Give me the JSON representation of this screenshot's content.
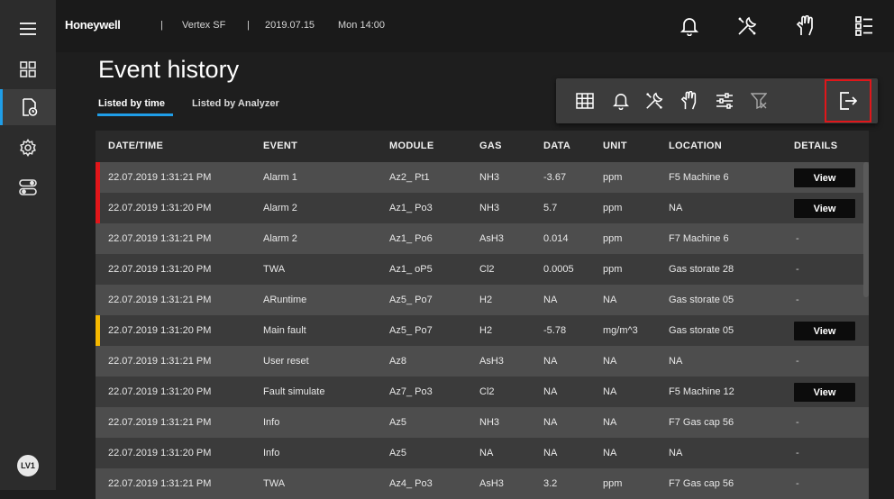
{
  "brand": "Honeywell",
  "header": {
    "separator": "|",
    "site": "Vertex SF",
    "date": "2019.07.15",
    "time": "Mon 14:00"
  },
  "page_title": "Event history",
  "tabs": [
    {
      "label": "Listed by time",
      "active": true
    },
    {
      "label": "Listed by Analyzer",
      "active": false
    }
  ],
  "user_badge": "LV1",
  "columns": [
    "DATE/TIME",
    "EVENT",
    "MODULE",
    "GAS",
    "DATA",
    "UNIT",
    "LOCATION",
    "DETAILS"
  ],
  "rows": [
    {
      "datetime": "22.07.2019 1:31:21 PM",
      "event": "Alarm 1",
      "module": "Az2_ Pt1",
      "gas": "NH3",
      "data": "-3.67",
      "unit": "ppm",
      "location": "F5 Machine 6",
      "details": "View",
      "marker": "#e0161a"
    },
    {
      "datetime": "22.07.2019 1:31:20 PM",
      "event": "Alarm 2",
      "module": "Az1_ Po3",
      "gas": "NH3",
      "data": "5.7",
      "unit": "ppm",
      "location": "NA",
      "details": "View",
      "marker": "#e0161a"
    },
    {
      "datetime": "22.07.2019 1:31:21 PM",
      "event": "Alarm 2",
      "module": "Az1_ Po6",
      "gas": "AsH3",
      "data": "0.014",
      "unit": "ppm",
      "location": "F7 Machine 6",
      "details": "-",
      "marker": ""
    },
    {
      "datetime": "22.07.2019 1:31:20 PM",
      "event": "TWA",
      "module": "Az1_ oP5",
      "gas": "Cl2",
      "data": "0.0005",
      "unit": "ppm",
      "location": "Gas storate 28",
      "details": "-",
      "marker": ""
    },
    {
      "datetime": "22.07.2019 1:31:21 PM",
      "event": "ARuntime",
      "module": "Az5_ Po7",
      "gas": "H2",
      "data": "NA",
      "unit": "NA",
      "location": "Gas storate 05",
      "details": "-",
      "marker": ""
    },
    {
      "datetime": "22.07.2019 1:31:20 PM",
      "event": "Main fault",
      "module": "Az5_ Po7",
      "gas": "H2",
      "data": "-5.78",
      "unit": "mg/m^3",
      "location": "Gas storate 05",
      "details": "View",
      "marker": "#f5b800"
    },
    {
      "datetime": "22.07.2019 1:31:21 PM",
      "event": "User reset",
      "module": "Az8",
      "gas": "AsH3",
      "data": "NA",
      "unit": "NA",
      "location": "NA",
      "details": "-",
      "marker": ""
    },
    {
      "datetime": "22.07.2019 1:31:20 PM",
      "event": "Fault simulate",
      "module": "Az7_ Po3",
      "gas": "Cl2",
      "data": "NA",
      "unit": "NA",
      "location": "F5 Machine 12",
      "details": "View",
      "marker": ""
    },
    {
      "datetime": "22.07.2019 1:31:21 PM",
      "event": "Info",
      "module": "Az5",
      "gas": "NH3",
      "data": "NA",
      "unit": "NA",
      "location": "F7 Gas cap 56",
      "details": "-",
      "marker": ""
    },
    {
      "datetime": "22.07.2019 1:31:20 PM",
      "event": "Info",
      "module": "Az5",
      "gas": "NA",
      "data": "NA",
      "unit": "NA",
      "location": "NA",
      "details": "-",
      "marker": ""
    },
    {
      "datetime": "22.07.2019 1:31:21 PM",
      "event": "TWA",
      "module": "Az4_ Po3",
      "gas": "AsH3",
      "data": "3.2",
      "unit": "ppm",
      "location": "F7 Gas cap 56",
      "details": "-",
      "marker": ""
    }
  ],
  "icons": {
    "sidebar": [
      "menu-icon",
      "dashboard-icon",
      "event-history-icon",
      "settings-icon",
      "toggle-icon"
    ],
    "topbar": [
      "bell-icon",
      "tools-icon",
      "hand-icon",
      "list-icon"
    ],
    "toolbar": [
      "grid-icon",
      "bell-icon",
      "tools-icon",
      "hand-icon",
      "sliders-icon",
      "filter-clear-icon",
      "export-icon"
    ]
  },
  "colors": {
    "accent": "#1f9ee8",
    "alarm": "#e0161a",
    "warning": "#f5b800",
    "highlight_box": "#e0161a"
  }
}
